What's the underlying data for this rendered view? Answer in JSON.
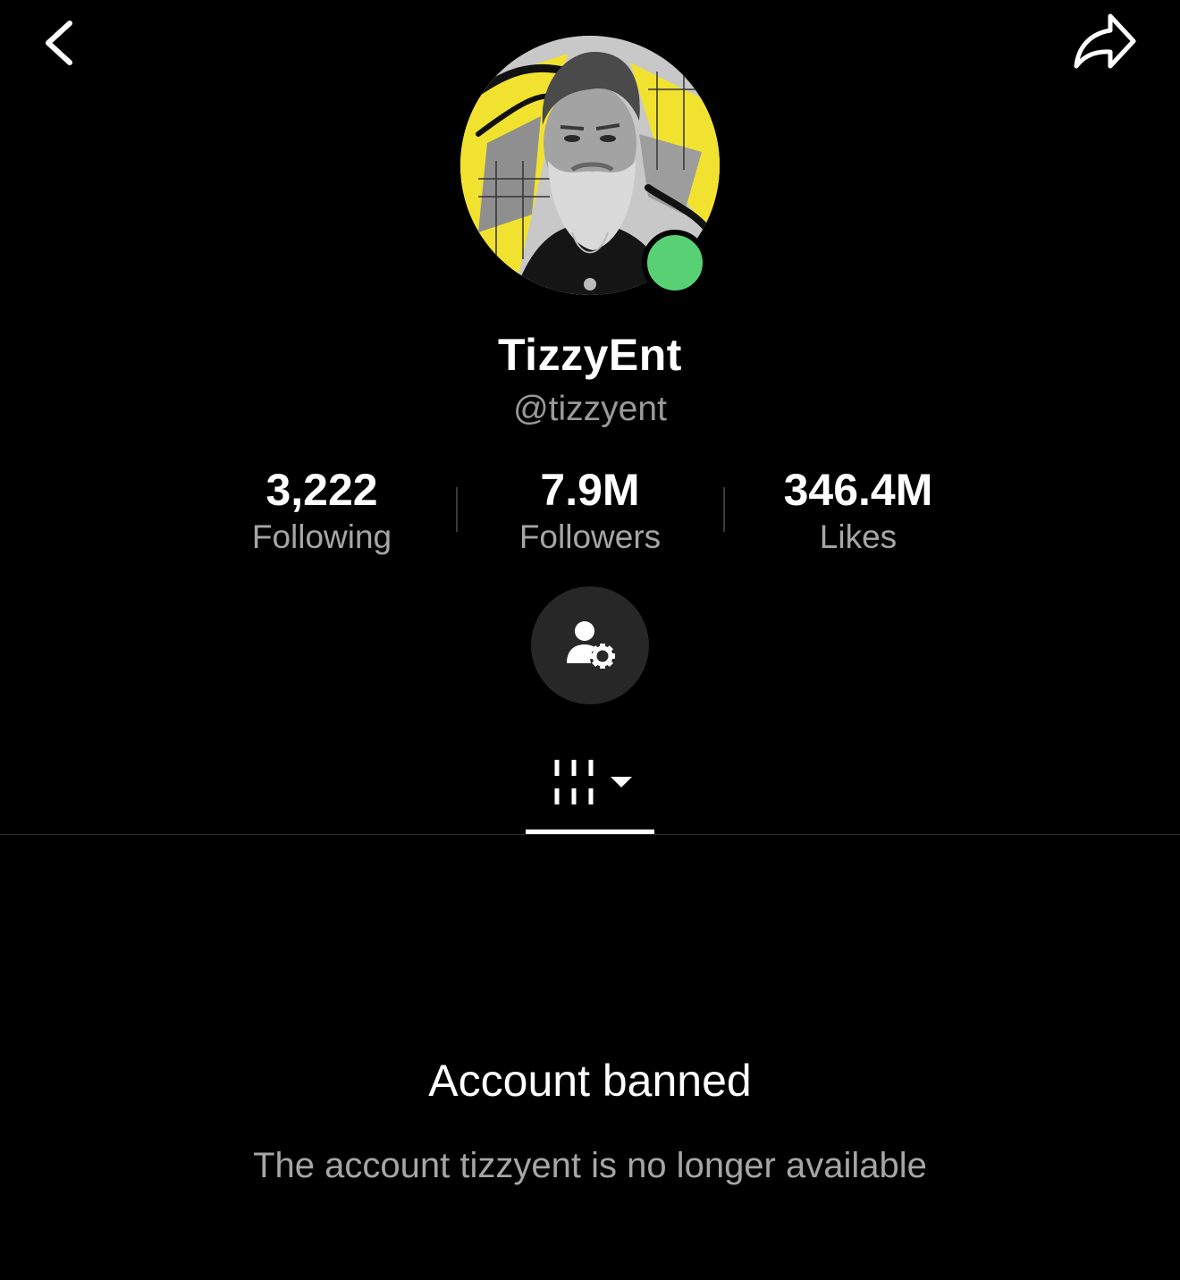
{
  "header": {
    "back_icon": "chevron-left-icon",
    "share_icon": "share-arrow-icon"
  },
  "profile": {
    "display_name": "TizzyEnt",
    "username": "@tizzyent",
    "avatar_description_colors": [
      "#f2e230",
      "#9e9e9e",
      "#1a1a1a"
    ],
    "online_status_color": "#57d173"
  },
  "stats": {
    "following": {
      "value": "3,222",
      "label": "Following"
    },
    "followers": {
      "value": "7.9M",
      "label": "Followers"
    },
    "likes": {
      "value": "346.4M",
      "label": "Likes"
    }
  },
  "actions": {
    "profile_settings_icon": "person-gear-icon"
  },
  "tabs": {
    "active_icon": "video-grid-icon",
    "dropdown_icon": "caret-down-icon"
  },
  "notice": {
    "title": "Account banned",
    "message": "The account tizzyent is no longer available"
  }
}
